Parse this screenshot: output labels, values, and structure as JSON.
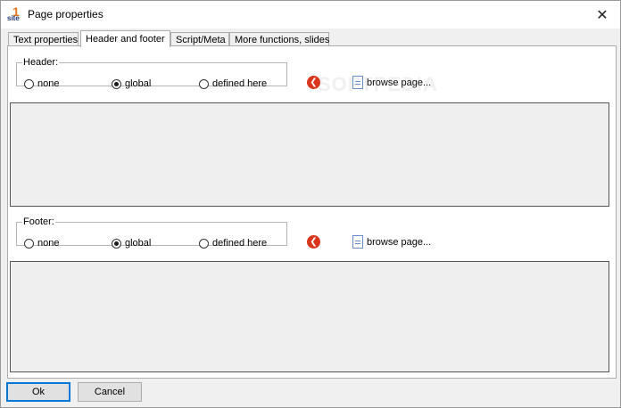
{
  "window": {
    "app_icon_number": "1",
    "app_icon_word": "site",
    "title": "Page properties",
    "close_glyph": "✕"
  },
  "tabs": [
    {
      "label": "Text properties",
      "active": false
    },
    {
      "label": "Header and footer",
      "active": true
    },
    {
      "label": "Script/Meta",
      "active": false
    },
    {
      "label": "More functions, slides",
      "active": false
    }
  ],
  "header": {
    "legend": "Header:",
    "options": [
      "none",
      "global",
      "defined here"
    ],
    "selected": "global",
    "browse_label": "browse page..."
  },
  "footer": {
    "legend": "Footer:",
    "options": [
      "none",
      "global",
      "defined here"
    ],
    "selected": "global",
    "browse_label": "browse page..."
  },
  "watermark": "SOFTPEDIA",
  "buttons": {
    "ok": "Ok",
    "cancel": "Cancel"
  },
  "icons": {
    "back": "back-arrow-icon",
    "browse": "document-icon",
    "close": "close-icon"
  },
  "colors": {
    "back_icon": "#d9361d",
    "accent": "#0078d7"
  }
}
